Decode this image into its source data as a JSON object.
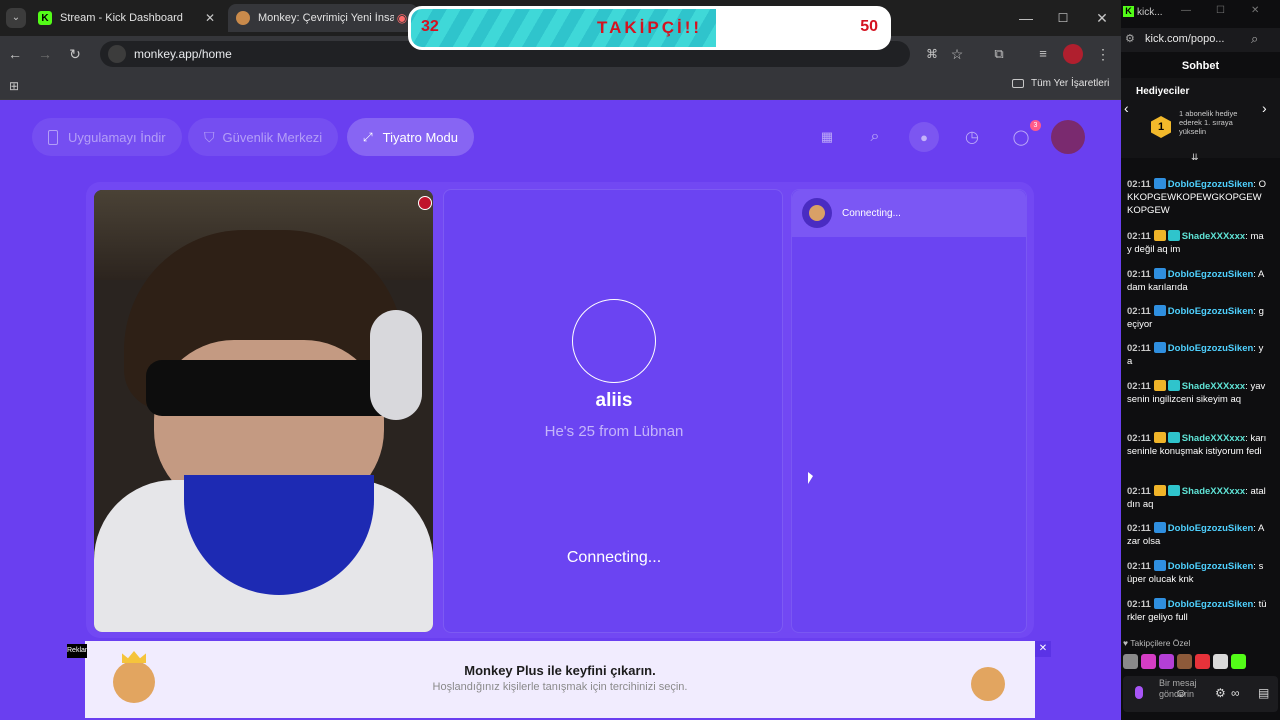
{
  "browser": {
    "tabs": [
      {
        "title": "Stream - Kick Dashboard",
        "favicon": "kick-icon"
      },
      {
        "title": "Monkey: Çevrimiçi Yeni İnsa",
        "favicon": "monkey-icon"
      }
    ],
    "url": "monkey.app/home",
    "bookmarks_label": "Tüm Yer İşaretleri"
  },
  "overlay": {
    "left_count": "32",
    "label": "TAKİPÇİ!!",
    "right_count": "50",
    "progress_fraction": 0.64
  },
  "monkey": {
    "nav": {
      "download_app": "Uygulamayı İndir",
      "safety_center": "Güvenlik Merkezi",
      "theater_mode": "Tiyatro Modu",
      "notif_badge": "3"
    },
    "partner": {
      "name": "aliis",
      "subtitle": "He's 25 from Lübnan",
      "status": "Connecting..."
    },
    "chat": {
      "status": "Connecting..."
    },
    "promo": {
      "title": "Monkey Plus ile keyfini çıkarın.",
      "subtitle": "Hoşlandığınız kişilerle tanışmak için tercihinizi seçin.",
      "side_label": "Reklam"
    }
  },
  "kick": {
    "window_title": "kick...",
    "url": "kick.com/popo...",
    "chat_title": "Sohbet",
    "gifters_title": "Hediyeciler",
    "gifters_rank": "1",
    "gifters_text": "1 abonelik hediye ederek 1. sıraya yükselin",
    "followers_only": "Takipçilere Özel",
    "input_placeholder": "Bir mesaj gönderin",
    "messages": [
      {
        "time": "02:11",
        "user": "DobloEgzozuSiken",
        "color": "#4fd1ff",
        "text": "OKKOPGEWKOPEWGKOPGEWKOPGEW"
      },
      {
        "time": "02:11",
        "user": "ShadeXXXxxx",
        "color": "#5fe3d6",
        "text": "may değil aq im"
      },
      {
        "time": "02:11",
        "user": "DobloEgzozuSiken",
        "color": "#4fd1ff",
        "text": "Adam karılarıda"
      },
      {
        "time": "02:11",
        "user": "DobloEgzozuSiken",
        "color": "#4fd1ff",
        "text": "geçiyor"
      },
      {
        "time": "02:11",
        "user": "DobloEgzozuSiken",
        "color": "#4fd1ff",
        "text": "ya"
      },
      {
        "time": "02:11",
        "user": "ShadeXXXxxx",
        "color": "#5fe3d6",
        "text": "yav senin ingilizceni sikeyim aq"
      },
      {
        "time": "02:11",
        "user": "ShadeXXXxxx",
        "color": "#5fe3d6",
        "text": "karı seninle konuşmak istiyorum fedi"
      },
      {
        "time": "02:11",
        "user": "ShadeXXXxxx",
        "color": "#5fe3d6",
        "text": "ataldın aq"
      },
      {
        "time": "02:11",
        "user": "DobloEgzozuSiken",
        "color": "#4fd1ff",
        "text": "Azar olsa"
      },
      {
        "time": "02:11",
        "user": "DobloEgzozuSiken",
        "color": "#4fd1ff",
        "text": "süper olucak knk"
      },
      {
        "time": "02:11",
        "user": "DobloEgzozuSiken",
        "color": "#4fd1ff",
        "text": "türkler geliyo full"
      }
    ]
  }
}
